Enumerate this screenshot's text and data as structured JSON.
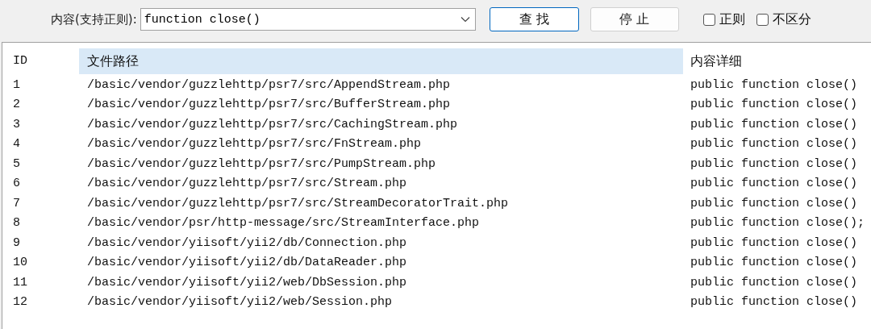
{
  "search_bar": {
    "label": "内容(支持正则):",
    "query": "function close()",
    "buttons": [
      {
        "label": "查 找",
        "kind": "primary"
      },
      {
        "label": "停 止",
        "kind": "normal"
      }
    ],
    "options": [
      {
        "label": "正则",
        "checked": false
      },
      {
        "label": "不区分",
        "checked": false
      }
    ]
  },
  "table": {
    "columns": [
      {
        "label": "ID",
        "selected": false
      },
      {
        "label": "文件路径",
        "selected": true
      },
      {
        "label": "内容详细",
        "selected": false
      }
    ],
    "rows": [
      [
        "1",
        "/basic/vendor/guzzlehttp/psr7/src/AppendStream.php",
        "public function close()"
      ],
      [
        "2",
        "/basic/vendor/guzzlehttp/psr7/src/BufferStream.php",
        "public function close()"
      ],
      [
        "3",
        "/basic/vendor/guzzlehttp/psr7/src/CachingStream.php",
        "public function close()"
      ],
      [
        "4",
        "/basic/vendor/guzzlehttp/psr7/src/FnStream.php",
        "public function close()"
      ],
      [
        "5",
        "/basic/vendor/guzzlehttp/psr7/src/PumpStream.php",
        "public function close()"
      ],
      [
        "6",
        "/basic/vendor/guzzlehttp/psr7/src/Stream.php",
        "public function close()"
      ],
      [
        "7",
        "/basic/vendor/guzzlehttp/psr7/src/StreamDecoratorTrait.php",
        "public function close()"
      ],
      [
        "8",
        "/basic/vendor/psr/http-message/src/StreamInterface.php",
        "public function close();"
      ],
      [
        "9",
        "/basic/vendor/yiisoft/yii2/db/Connection.php",
        "public function close()"
      ],
      [
        "10",
        "/basic/vendor/yiisoft/yii2/db/DataReader.php",
        "public function close()"
      ],
      [
        "11",
        "/basic/vendor/yiisoft/yii2/web/DbSession.php",
        "public function close()"
      ],
      [
        "12",
        "/basic/vendor/yiisoft/yii2/web/Session.php",
        "public function close()"
      ]
    ]
  }
}
